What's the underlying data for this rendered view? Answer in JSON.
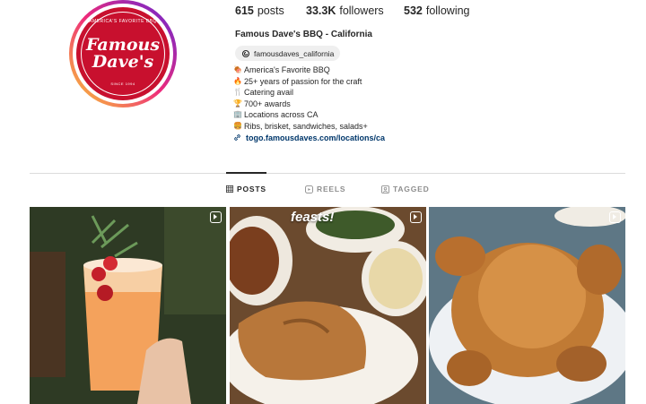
{
  "profile": {
    "avatar": {
      "logo_top": "AMERICA'S FAVORITE BBQ",
      "logo_line1": "Famous",
      "logo_line2": "Dave's",
      "logo_bottom": "SINCE 1994",
      "brand_color": "#c8102e"
    },
    "stats": {
      "posts_value": "615",
      "posts_label": "posts",
      "followers_value": "33.3K",
      "followers_label": "followers",
      "following_value": "532",
      "following_label": "following"
    },
    "name": "Famous Dave's BBQ - California",
    "threads_handle": "famousdaves_california",
    "bio": [
      {
        "icon": "ribs-emoji",
        "text": "America's Favorite BBQ"
      },
      {
        "icon": "fire-emoji",
        "text": "25+ years of passion for the craft"
      },
      {
        "icon": "fork-emoji",
        "text": "Catering avail"
      },
      {
        "icon": "trophy-emoji",
        "text": "700+ awards"
      },
      {
        "icon": "building-emoji",
        "text": "Locations across CA"
      },
      {
        "icon": "bbq-emoji",
        "text": "Ribs, brisket, sandwiches, salads+"
      }
    ],
    "link": "togo.famousdaves.com/locations/ca"
  },
  "tabs": [
    {
      "label": "POSTS",
      "icon": "grid-icon",
      "active": true
    },
    {
      "label": "REELS",
      "icon": "reels-icon",
      "active": false
    },
    {
      "label": "TAGGED",
      "icon": "tagged-icon",
      "active": false
    }
  ],
  "grid": [
    {
      "type": "reel",
      "overlay": ""
    },
    {
      "type": "reel",
      "overlay": "feasts!"
    },
    {
      "type": "reel",
      "overlay": ""
    }
  ],
  "colors": {
    "link": "#00376b",
    "divider": "#dbdbdb",
    "muted": "#8e8e8e"
  }
}
